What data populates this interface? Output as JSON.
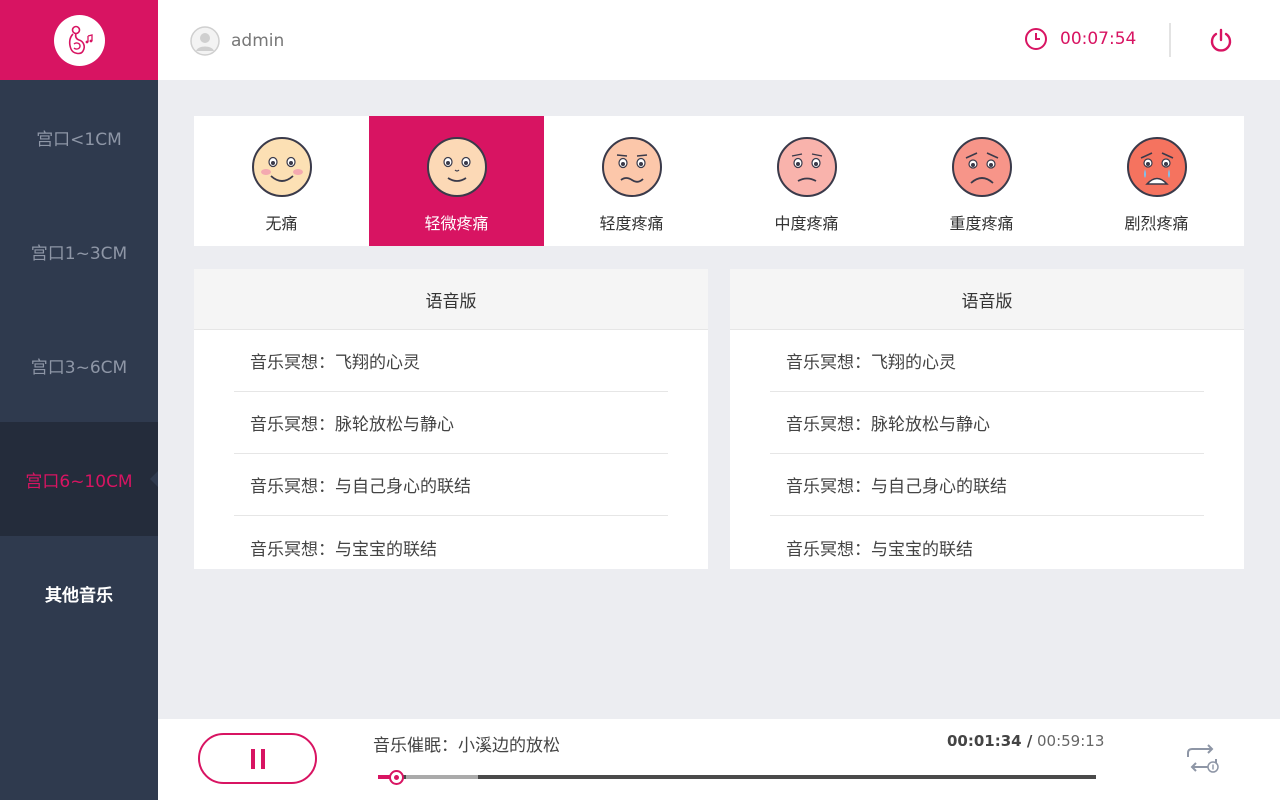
{
  "colors": {
    "accent": "#d81462",
    "sidebar": "#2f3a4e",
    "sidebar_active": "#242c3b"
  },
  "header": {
    "username": "admin",
    "timer": "00:07:54"
  },
  "sidebar": {
    "items": [
      {
        "label": "宫口<1CM"
      },
      {
        "label": "宫口1~3CM"
      },
      {
        "label": "宫口3~6CM"
      },
      {
        "label": "宫口6~10CM",
        "active": true
      },
      {
        "label": "其他音乐"
      }
    ]
  },
  "pain_scale": {
    "items": [
      {
        "label": "无痛",
        "icon": "smile-face-icon"
      },
      {
        "label": "轻微疼痛",
        "icon": "slight-smile-face-icon",
        "selected": true
      },
      {
        "label": "轻度疼痛",
        "icon": "mild-pain-face-icon"
      },
      {
        "label": "中度疼痛",
        "icon": "moderate-pain-face-icon"
      },
      {
        "label": "重度疼痛",
        "icon": "severe-pain-face-icon"
      },
      {
        "label": "剧烈疼痛",
        "icon": "crying-face-icon"
      }
    ]
  },
  "panels": [
    {
      "title": "语音版",
      "tracks": [
        "音乐冥想：飞翔的心灵",
        "音乐冥想：脉轮放松与静心",
        "音乐冥想：与自己身心的联结",
        "音乐冥想：与宝宝的联结"
      ]
    },
    {
      "title": "语音版",
      "tracks": [
        "音乐冥想：飞翔的心灵",
        "音乐冥想：脉轮放松与静心",
        "音乐冥想：与自己身心的联结",
        "音乐冥想：与宝宝的联结"
      ]
    }
  ],
  "player": {
    "now_playing": "音乐催眠：小溪边的放松",
    "current_time": "00:01:34 /",
    "total_time": "00:59:13",
    "progress_fraction": 0.027,
    "buffered_fraction": 0.14
  }
}
